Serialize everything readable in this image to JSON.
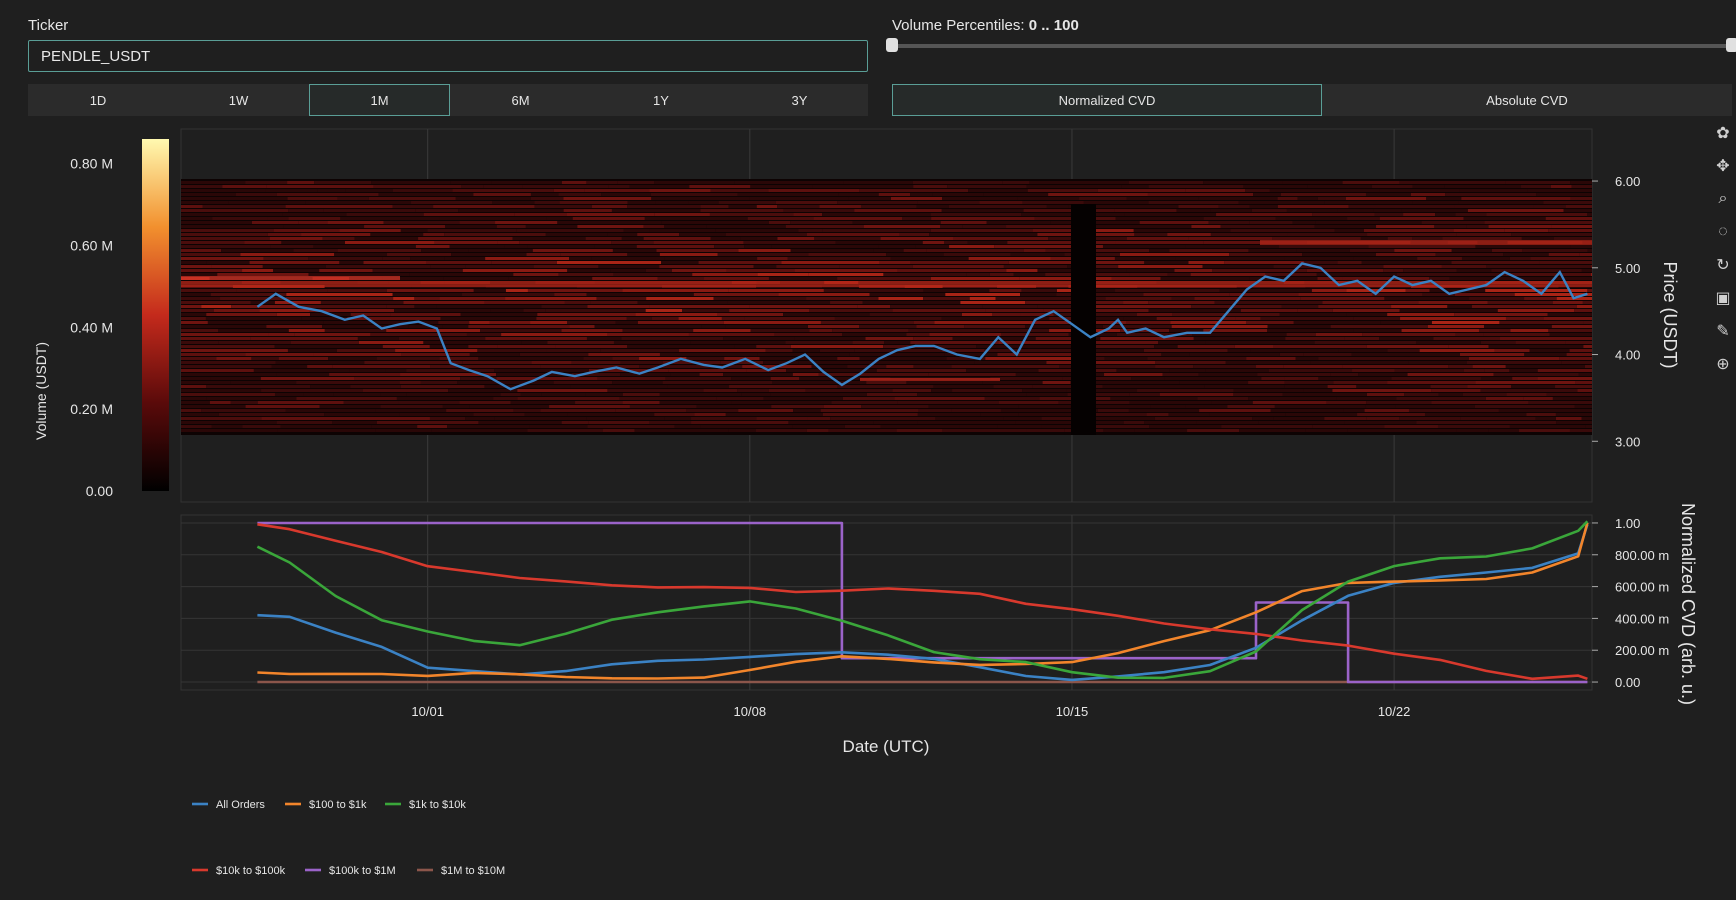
{
  "ticker": {
    "label": "Ticker",
    "value": "PENDLE_USDT"
  },
  "ranges": [
    "1D",
    "1W",
    "1M",
    "6M",
    "1Y",
    "3Y"
  ],
  "active_range": "1M",
  "percentiles": {
    "label": "Volume Percentiles:",
    "value": "0 .. 100",
    "low": 0,
    "high": 100
  },
  "modes": [
    "Normalized CVD",
    "Absolute CVD"
  ],
  "active_mode": "Normalized CVD",
  "toolbar": [
    "plotly-logo-icon",
    "pan-icon",
    "zoom-icon",
    "lasso-select-icon",
    "reset-axes-icon",
    "save-icon",
    "comment-icon",
    "spike-lines-icon"
  ],
  "colors": {
    "accent": "#5a9e96",
    "background": "#1f1f1f",
    "plot_bg": "#1f1f1f"
  },
  "chart_data": [
    {
      "type": "heatmap",
      "ylabel": "Price (USDT)",
      "y_ticks": [
        "3.00",
        "4.00",
        "5.00",
        "6.00"
      ],
      "ylim": [
        2.3,
        6.6
      ],
      "colorbar": {
        "label": "Volume (USDT)",
        "ticks": [
          "0.00",
          "0.20 M",
          "0.40 M",
          "0.60 M",
          "0.80 M"
        ],
        "range": [
          0,
          0.86
        ]
      },
      "x_ticks": [
        "10/01",
        "10/08",
        "10/15",
        "10/22"
      ],
      "price_series": {
        "name": "Price",
        "color": "#3b82c4",
        "days": [
          -3.7,
          -3.3,
          -2.8,
          -2.3,
          -1.8,
          -1.4,
          -1.0,
          -0.6,
          -0.2,
          0.2,
          0.5,
          0.9,
          1.3,
          1.8,
          2.3,
          2.7,
          3.2,
          3.6,
          4.1,
          4.6,
          5.0,
          5.5,
          6.0,
          6.4,
          6.9,
          7.4,
          7.8,
          8.2,
          8.6,
          9.0,
          9.4,
          9.8,
          10.2,
          10.6,
          11.0,
          11.5,
          12.0,
          12.4,
          12.8,
          13.2,
          13.6,
          14.0,
          14.4,
          14.8,
          15.0,
          15.2,
          15.6,
          16.0,
          16.5,
          17.0,
          17.4,
          17.8,
          18.2,
          18.6,
          19.0,
          19.4,
          19.8,
          20.2,
          20.6,
          21.0,
          21.4,
          21.8,
          22.2,
          22.6,
          23.0,
          23.4,
          23.8,
          24.2,
          24.6,
          24.9,
          25.2
        ],
        "values": [
          4.55,
          4.7,
          4.55,
          4.5,
          4.4,
          4.45,
          4.3,
          4.35,
          4.38,
          4.3,
          3.9,
          3.82,
          3.75,
          3.6,
          3.7,
          3.8,
          3.75,
          3.8,
          3.85,
          3.78,
          3.85,
          3.95,
          3.88,
          3.85,
          3.95,
          3.82,
          3.9,
          4.0,
          3.8,
          3.65,
          3.78,
          3.95,
          4.05,
          4.1,
          4.1,
          4.0,
          3.95,
          4.2,
          4.0,
          4.4,
          4.5,
          4.35,
          4.2,
          4.3,
          4.4,
          4.25,
          4.3,
          4.2,
          4.25,
          4.25,
          4.5,
          4.75,
          4.9,
          4.85,
          5.05,
          5.0,
          4.8,
          4.85,
          4.7,
          4.9,
          4.8,
          4.85,
          4.7,
          4.75,
          4.8,
          4.95,
          4.85,
          4.7,
          4.95,
          4.65,
          4.7
        ]
      }
    },
    {
      "type": "line",
      "xlabel": "Date (UTC)",
      "ylabel": "Normalized CVD (arb. u.)",
      "y_ticks": [
        "0.00",
        "200.00 m",
        "400.00 m",
        "600.00 m",
        "800.00 m",
        "1.00"
      ],
      "ylim": [
        -0.05,
        1.05
      ],
      "x_ticks": [
        "10/01",
        "10/08",
        "10/15",
        "10/22"
      ],
      "x_days": [
        -3.7,
        -3.0,
        -2.0,
        -1.0,
        0.0,
        1.0,
        2.0,
        3.0,
        4.0,
        5.0,
        6.0,
        7.0,
        8.0,
        9.0,
        10.0,
        11.0,
        12.0,
        13.0,
        14.0,
        15.0,
        16.0,
        17.0,
        18.0,
        19.0,
        20.0,
        21.0,
        22.0,
        23.0,
        24.0,
        25.0,
        25.2
      ],
      "series": [
        {
          "name": "All Orders",
          "color": "#3b82c4",
          "values": [
            0.42,
            0.4,
            0.3,
            0.22,
            0.1,
            0.08,
            0.05,
            0.06,
            0.1,
            0.13,
            0.15,
            0.17,
            0.18,
            0.18,
            0.16,
            0.14,
            0.1,
            0.05,
            0.02,
            0.03,
            0.05,
            0.1,
            0.22,
            0.4,
            0.55,
            0.62,
            0.65,
            0.68,
            0.72,
            0.82,
            1.0
          ]
        },
        {
          "name": "$100 to $1k",
          "color": "#f2852b",
          "values": [
            0.05,
            0.04,
            0.05,
            0.06,
            0.05,
            0.06,
            0.04,
            0.02,
            0.02,
            0.03,
            0.04,
            0.08,
            0.12,
            0.15,
            0.14,
            0.13,
            0.12,
            0.12,
            0.12,
            0.17,
            0.25,
            0.33,
            0.45,
            0.58,
            0.62,
            0.62,
            0.63,
            0.65,
            0.7,
            0.8,
            1.0
          ]
        },
        {
          "name": "$1k to $10k",
          "color": "#3aa63a",
          "values": [
            0.84,
            0.75,
            0.55,
            0.4,
            0.32,
            0.25,
            0.22,
            0.3,
            0.4,
            0.45,
            0.48,
            0.5,
            0.45,
            0.38,
            0.3,
            0.2,
            0.15,
            0.12,
            0.05,
            0.02,
            0.03,
            0.08,
            0.2,
            0.45,
            0.62,
            0.72,
            0.78,
            0.8,
            0.85,
            0.95,
            1.0
          ]
        },
        {
          "name": "$10k to $100k",
          "color": "#d8392d",
          "values": [
            0.99,
            0.97,
            0.9,
            0.82,
            0.72,
            0.68,
            0.65,
            0.64,
            0.62,
            0.6,
            0.59,
            0.58,
            0.56,
            0.58,
            0.6,
            0.58,
            0.55,
            0.48,
            0.45,
            0.42,
            0.38,
            0.34,
            0.3,
            0.25,
            0.22,
            0.18,
            0.15,
            0.08,
            0.02,
            0.03,
            0.01
          ]
        },
        {
          "name": "$100k to $1M",
          "color": "#9b63c9",
          "values": [
            1.0,
            1.0,
            1.0,
            1.0,
            1.0,
            1.0,
            1.0,
            1.0,
            1.0,
            1.0,
            1.0,
            1.0,
            1.0,
            0.15,
            0.15,
            0.15,
            0.15,
            0.15,
            0.15,
            0.15,
            0.15,
            0.15,
            0.5,
            0.5,
            0.0,
            0.0,
            0.0,
            0.0,
            0.0,
            0.0,
            0.0
          ]
        },
        {
          "name": "$1M to $10M",
          "color": "#8c564b",
          "values": [
            0.0,
            0.0,
            0.0,
            0.0,
            0.0,
            0.0,
            0.0,
            0.0,
            0.0,
            0.0,
            0.0,
            0.0,
            0.0,
            0.0,
            0.0,
            0.0,
            0.0,
            0.0,
            0.0,
            0.0,
            0.0,
            0.0,
            0.0,
            0.0,
            0.0,
            0.0,
            0.0,
            0.0,
            0.0,
            0.0,
            0.0
          ]
        }
      ]
    }
  ]
}
